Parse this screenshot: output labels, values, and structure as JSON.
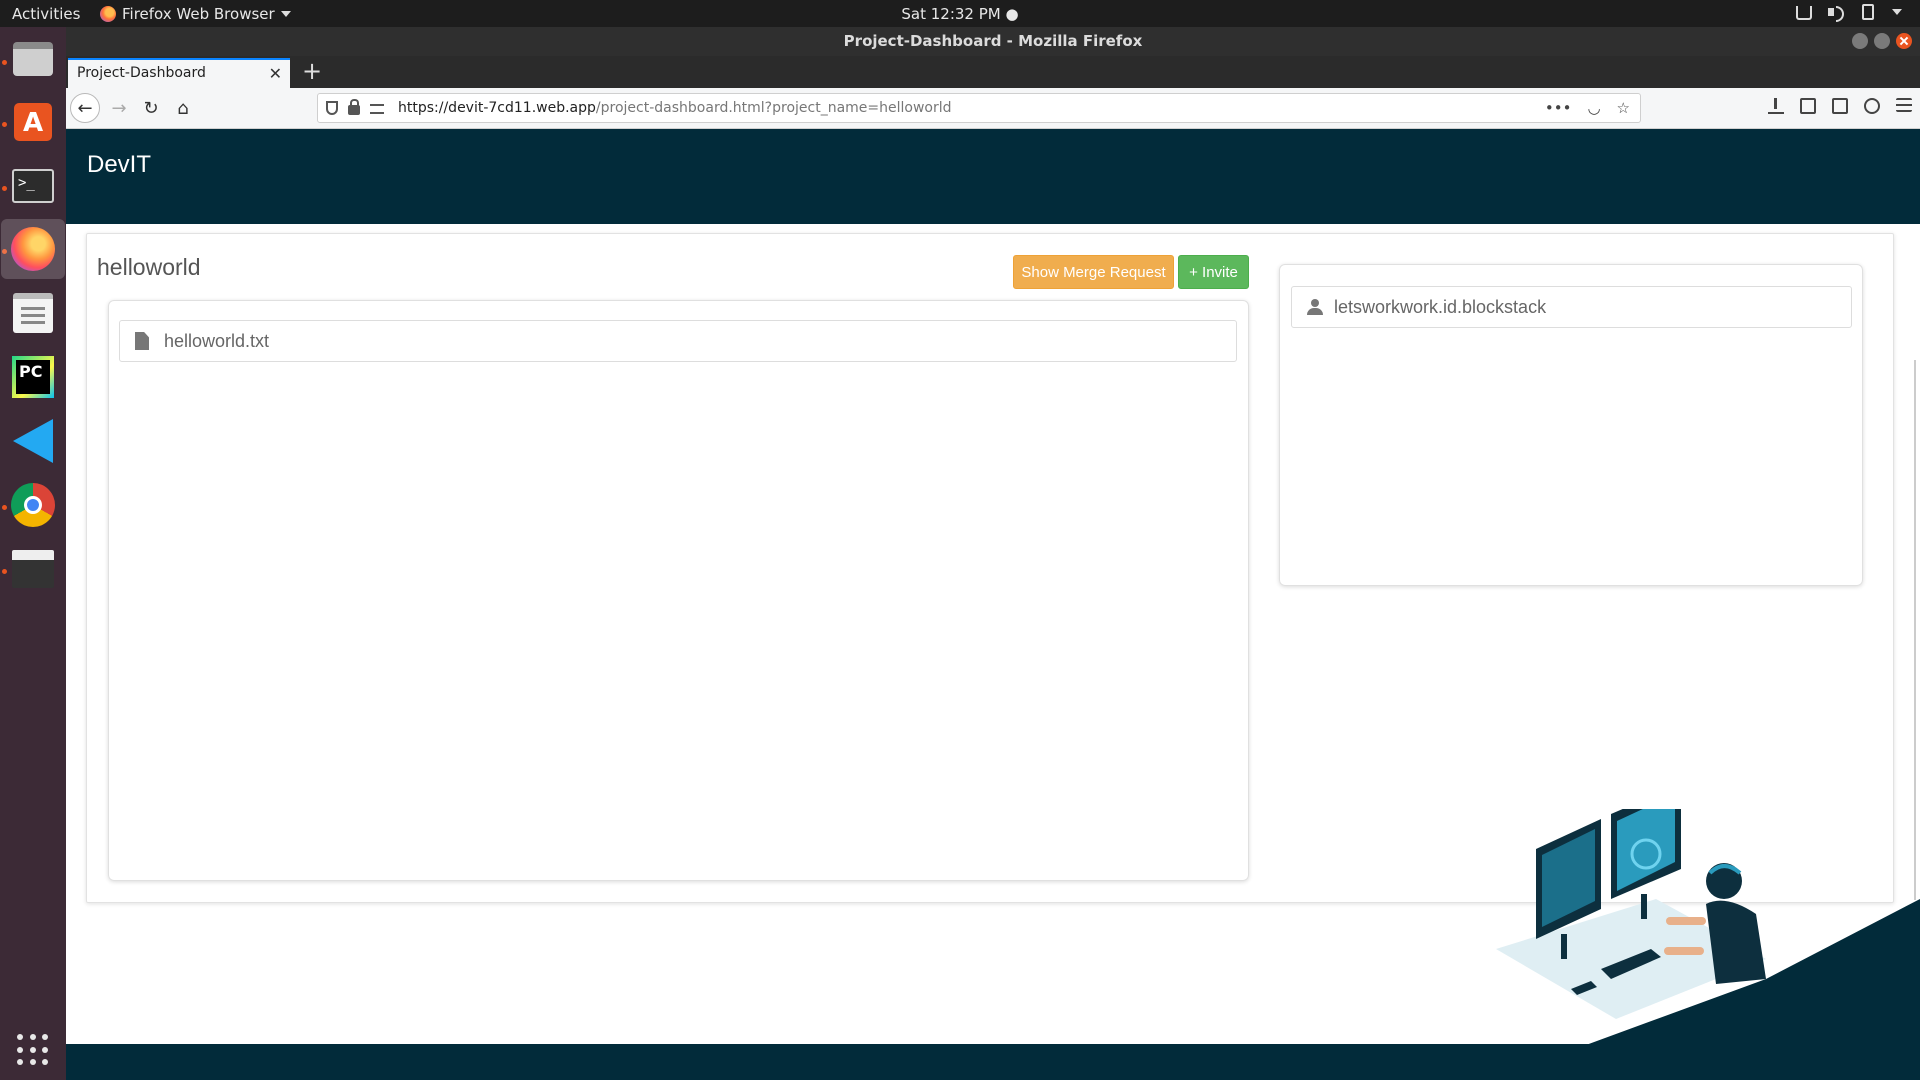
{
  "system_bar": {
    "activities": "Activities",
    "app_name": "Firefox Web Browser",
    "clock": "Sat 12:32 PM"
  },
  "window": {
    "title": "Project-Dashboard - Mozilla Firefox"
  },
  "dock": {
    "items": [
      "files-icon",
      "software-store-icon",
      "terminal-icon",
      "firefox-icon",
      "text-editor-icon",
      "pycharm-icon",
      "vscode-icon",
      "chrome-icon",
      "video-editor-icon",
      "show-apps-icon"
    ],
    "accent": "#e95420"
  },
  "browser": {
    "tab_title": "Project-Dashboard",
    "url_host": "https://devit-7cd11.web.app",
    "url_path": "/project-dashboard.html?project_name=helloworld"
  },
  "site": {
    "brand": "DevIT",
    "header_color": "#022b3a"
  },
  "project": {
    "name": "helloworld",
    "merge_button": "Show Merge Request",
    "invite_button": "+ Invite",
    "merge_color": "#f0ad4e",
    "invite_color": "#5cb85c",
    "files": [
      "helloworld.txt"
    ],
    "members": [
      "letsworkwork.id.blockstack"
    ]
  }
}
